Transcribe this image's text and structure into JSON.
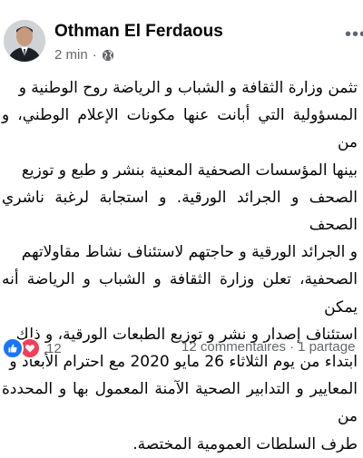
{
  "post": {
    "author": "Othman El Ferdaous",
    "time": "2 min",
    "separator": "·",
    "privacy_icon": "globe-icon",
    "menu_icon": "more-horizontal-icon",
    "lines": [
      "تثمن وزارة الثقافة و الشباب و الرياضة روح الوطنية و",
      "المسؤولية التي أبانت عنها مكونات الإعلام الوطني، و من",
      "بينها المؤسسات الصحفية المعنية بنشر و طبع و توزيع",
      "الصحف و الجرائد الورقية. و استجابة لرغبة ناشري الصحف",
      "و الجرائد الورقية و حاجتهم لاستئناف نشاط مقاولاتهم",
      "الصحفية، تعلن وزارة الثقافة و الشباب و الرياضة أنه يمكن",
      "استئناف إصدار و نشر و توزيع الطبعات الورقية، و ذلك",
      "ابتداء من يوم الثلاثاء 26 مايو 2020 مع احترام الأبعاد و",
      "المعايير و التدابير الصحية الآمنة المعمول بها و المحددة من",
      "طرف السلطات العمومية المختصة."
    ]
  },
  "footer": {
    "reaction_icons": [
      "like-icon",
      "love-icon"
    ],
    "reaction_count": "12",
    "comments": "12 commentaires",
    "separator": "·",
    "shares": "1 partage"
  },
  "colors": {
    "like": "#1877f2",
    "love": "#f33e58",
    "secondary_text": "#65676b"
  }
}
